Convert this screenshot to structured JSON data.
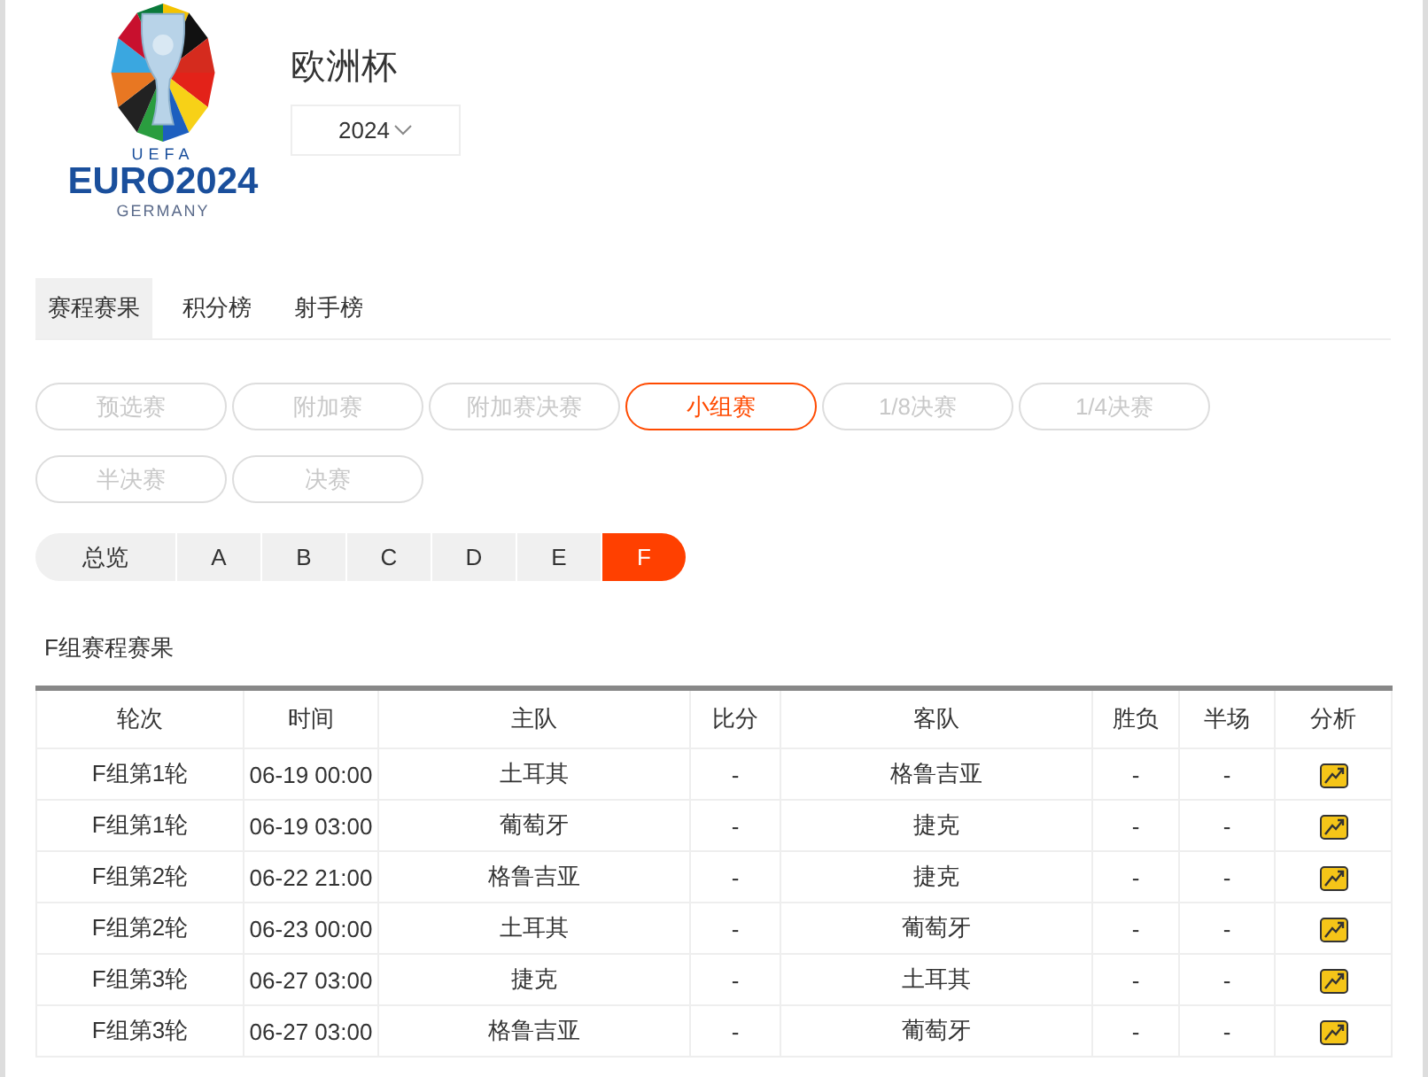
{
  "header": {
    "logo": {
      "top_text": "UEFA",
      "main_text": "EURO2024",
      "sub_text": "GERMANY"
    },
    "title": "欧洲杯",
    "season": "2024"
  },
  "tabs": [
    {
      "label": "赛程赛果",
      "selected": true
    },
    {
      "label": "积分榜",
      "selected": false
    },
    {
      "label": "射手榜",
      "selected": false
    }
  ],
  "stages": [
    {
      "label": "预选赛",
      "selected": false
    },
    {
      "label": "附加赛",
      "selected": false
    },
    {
      "label": "附加赛决赛",
      "selected": false
    },
    {
      "label": "小组赛",
      "selected": true
    },
    {
      "label": "1/8决赛",
      "selected": false
    },
    {
      "label": "1/4决赛",
      "selected": false
    },
    {
      "label": "半决赛",
      "selected": false
    },
    {
      "label": "决赛",
      "selected": false
    }
  ],
  "groups": [
    {
      "label": "总览",
      "selected": false
    },
    {
      "label": "A",
      "selected": false
    },
    {
      "label": "B",
      "selected": false
    },
    {
      "label": "C",
      "selected": false
    },
    {
      "label": "D",
      "selected": false
    },
    {
      "label": "E",
      "selected": false
    },
    {
      "label": "F",
      "selected": true
    }
  ],
  "table": {
    "title": "F组赛程赛果",
    "columns": [
      "轮次",
      "时间",
      "主队",
      "比分",
      "客队",
      "胜负",
      "半场",
      "分析"
    ],
    "rows": [
      {
        "round": "F组第1轮",
        "time": "06-19 00:00",
        "home": "土耳其",
        "score": "-",
        "away": "格鲁吉亚",
        "result": "-",
        "half": "-"
      },
      {
        "round": "F组第1轮",
        "time": "06-19 03:00",
        "home": "葡萄牙",
        "score": "-",
        "away": "捷克",
        "result": "-",
        "half": "-"
      },
      {
        "round": "F组第2轮",
        "time": "06-22 21:00",
        "home": "格鲁吉亚",
        "score": "-",
        "away": "捷克",
        "result": "-",
        "half": "-"
      },
      {
        "round": "F组第2轮",
        "time": "06-23 00:00",
        "home": "土耳其",
        "score": "-",
        "away": "葡萄牙",
        "result": "-",
        "half": "-"
      },
      {
        "round": "F组第3轮",
        "time": "06-27 03:00",
        "home": "捷克",
        "score": "-",
        "away": "土耳其",
        "result": "-",
        "half": "-"
      },
      {
        "round": "F组第3轮",
        "time": "06-27 03:00",
        "home": "格鲁吉亚",
        "score": "-",
        "away": "葡萄牙",
        "result": "-",
        "half": "-"
      }
    ]
  }
}
